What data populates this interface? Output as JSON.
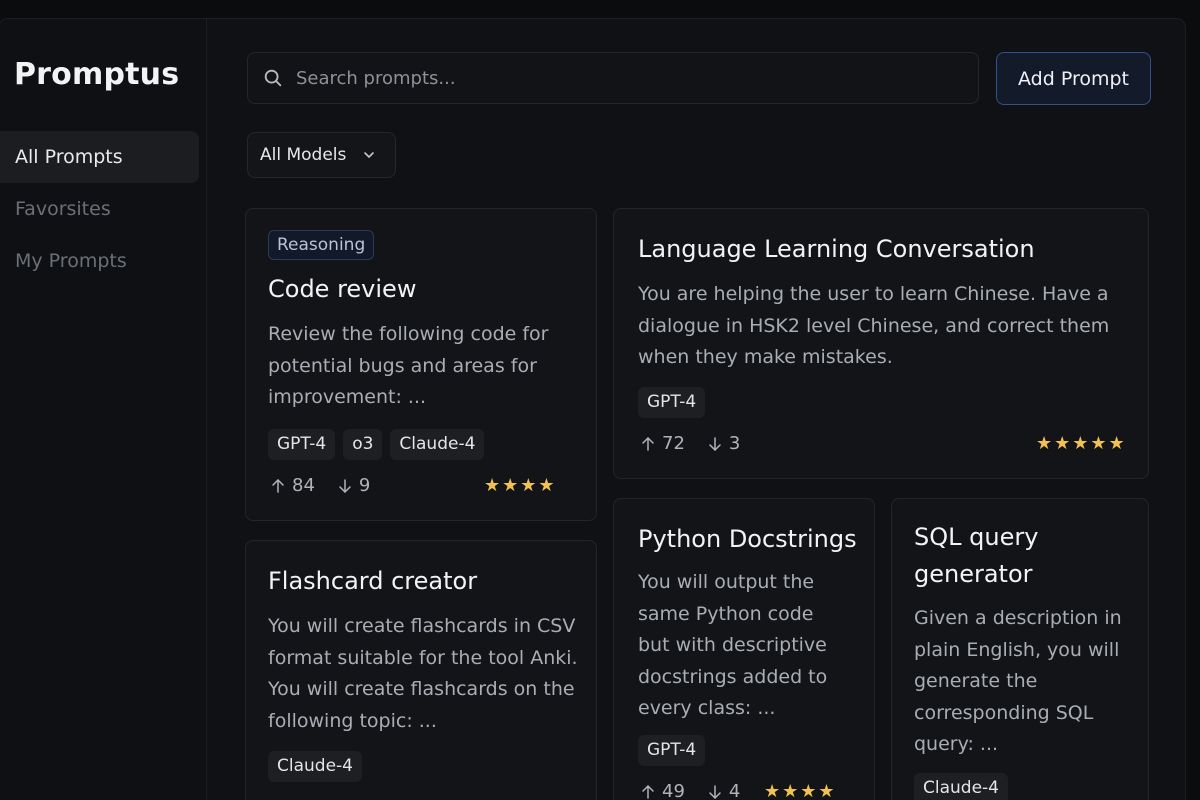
{
  "app": {
    "title": "Promptus"
  },
  "sidebar": {
    "items": [
      {
        "label": "All Prompts",
        "active": true
      },
      {
        "label": "Favorsites",
        "active": false
      },
      {
        "label": "My Prompts",
        "active": false
      }
    ]
  },
  "search": {
    "placeholder": "Search prompts...",
    "icon": "search-icon"
  },
  "toolbar": {
    "add_label": "Add Prompt"
  },
  "filter": {
    "label": "All Models",
    "icon": "chevron-down-icon"
  },
  "cards": [
    {
      "category": "Reasoning",
      "title": "Code review",
      "description": "Review the following code for potential bugs and areas for improvement: ...",
      "models": [
        "GPT-4",
        "o3",
        "Claude-4"
      ],
      "upvotes": "84",
      "downvotes": "9",
      "rating": "★★★★"
    },
    {
      "title": "Language Learning Conversation",
      "description": "You are helping the user to learn Chinese. Have a dialogue in HSK2 level Chinese, and correct them when they make mistakes.",
      "models": [
        "GPT-4"
      ],
      "upvotes": "72",
      "downvotes": "3",
      "rating": "★★★★★"
    },
    {
      "title": "Flashcard creator",
      "description": "You will create flashcards in CSV format suitable for the tool Anki. You will create flashcards on the following topic: ...",
      "models": [
        "Claude-4"
      ]
    },
    {
      "title": "Python Docstrings",
      "description": "You will output the same Python code but with descriptive docstrings added to every class: ...",
      "models": [
        "GPT-4"
      ],
      "upvotes": "49",
      "downvotes": "4",
      "rating": "★★★★"
    },
    {
      "title": "SQL query generator",
      "description": "Given a description in plain English, you will generate the corresponding SQL query: ...",
      "models": [
        "Claude-4"
      ]
    }
  ],
  "colors": {
    "background": "#101114",
    "accent_border": "#34508c",
    "star": "#f3c150"
  }
}
